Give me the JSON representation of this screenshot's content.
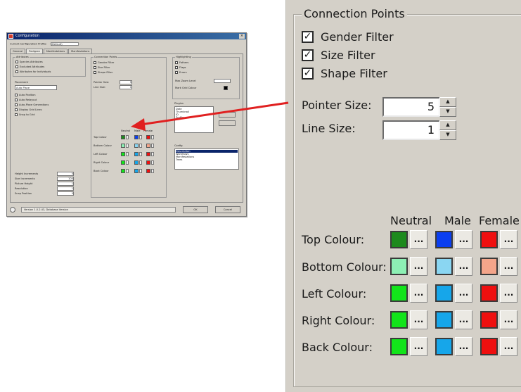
{
  "mini": {
    "title": "Configuration",
    "profile_label": "Current Configuration Profile:",
    "profile_value": "(Default)",
    "tabs": [
      "General",
      "Pedigree",
      "Manifestations",
      "Manifestations"
    ],
    "attributes_title": "Attributes",
    "attributes": [
      "Species Attributes",
      "Excluded Attributes",
      "Attributes for Individuals"
    ],
    "placement_title": "Placement",
    "placement_value": "Auto Place",
    "options": [
      "Auto Position",
      "Auto Relayout",
      "Auto-Place Generations",
      "Display Grid Lines",
      "Snap to Grid"
    ],
    "conn_title": "Connection Points",
    "conn": [
      "Gender Filter",
      "Size Filter",
      "Shape Filter"
    ],
    "pointer_label": "Pointer Size:",
    "pointer_value": "5",
    "line_label": "Line Size:",
    "line_value": "1",
    "col_heads": [
      "Neutral",
      "Male",
      "Female"
    ],
    "color_rows": [
      "Top Colour",
      "Bottom Colour",
      "Left Colour",
      "Right Colour",
      "Back Colour"
    ],
    "highlight_title": "Highlighting",
    "highlight": [
      "Fathers",
      "Flags",
      "Errors"
    ],
    "highlight_extra": [
      "Max Zoom Level",
      "Mark Grid Colour"
    ],
    "plugins_title": "Plugins",
    "plugins": [
      "Date",
      "Thumbnail",
      "ID",
      "Profile"
    ],
    "config_title": "Config",
    "config_items": [
      "Description",
      "Workflows",
      "Manifestations",
      "Trees"
    ],
    "bottom_fields": [
      "Height Increments",
      "Size Increments",
      "Picture Height",
      "Resolution",
      "Snap Position"
    ],
    "bottom_values": [
      "5",
      "100",
      "1",
      "1",
      "5"
    ],
    "status": "Version 1.0.2.43, Database Version",
    "ok": "OK",
    "cancel": "Cancel"
  },
  "zoom": {
    "group_title": "Connection Points",
    "filters": [
      {
        "label": "Gender Filter",
        "checked": true
      },
      {
        "label": "Size Filter",
        "checked": true
      },
      {
        "label": "Shape Filter",
        "checked": true
      }
    ],
    "pointer_size_label": "Pointer Size:",
    "pointer_size_value": "5",
    "line_size_label": "Line Size:",
    "line_size_value": "1",
    "columns": [
      "Neutral",
      "Male",
      "Female"
    ],
    "browse_label": "...",
    "rows": [
      {
        "label": "Top Colour:",
        "colors": [
          "#1d8a1d",
          "#0a3ef0",
          "#ef0f0f"
        ]
      },
      {
        "label": "Bottom Colour:",
        "colors": [
          "#8df0b4",
          "#8ad6f2",
          "#f4a58a"
        ]
      },
      {
        "label": "Left Colour:",
        "colors": [
          "#12e41a",
          "#16a6ea",
          "#ef0f0f"
        ]
      },
      {
        "label": "Right Colour:",
        "colors": [
          "#12e41a",
          "#16a6ea",
          "#ef0f0f"
        ]
      },
      {
        "label": "Back Colour:",
        "colors": [
          "#12e41a",
          "#16a6ea",
          "#ef0f0f"
        ]
      }
    ]
  },
  "arrow_color": "#e02020"
}
